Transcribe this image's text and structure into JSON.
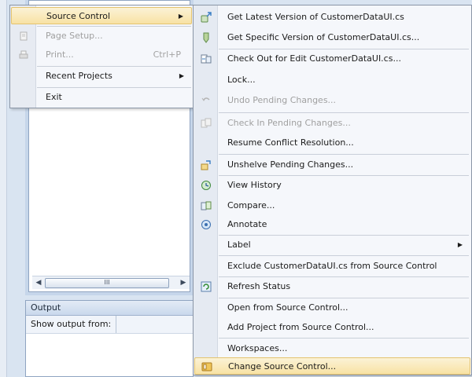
{
  "file_menu": {
    "items": [
      {
        "label": "Source Control",
        "shortcut": "",
        "submenu": true,
        "state": "highlighted",
        "icon": ""
      },
      {
        "label": "Page Setup...",
        "shortcut": "",
        "submenu": false,
        "state": "disabled",
        "icon": "page-setup-icon"
      },
      {
        "label": "Print...",
        "shortcut": "Ctrl+P",
        "submenu": false,
        "state": "disabled",
        "icon": "printer-icon"
      },
      {
        "label": "Recent Projects",
        "shortcut": "",
        "submenu": true,
        "state": "enabled",
        "icon": ""
      },
      {
        "label": "Exit",
        "shortcut": "",
        "submenu": false,
        "state": "enabled",
        "icon": ""
      }
    ]
  },
  "source_control_menu": {
    "items": [
      {
        "label": "Get Latest Version of CustomerDataUI.cs",
        "icon": "get-latest-icon",
        "state": "enabled"
      },
      {
        "label": "Get Specific Version of CustomerDataUI.cs...",
        "icon": "get-specific-icon",
        "state": "enabled"
      },
      {
        "label": "Check Out for Edit CustomerDataUI.cs...",
        "icon": "check-out-icon",
        "state": "enabled"
      },
      {
        "label": "Lock...",
        "icon": "",
        "state": "enabled"
      },
      {
        "label": "Undo Pending Changes...",
        "icon": "undo-icon",
        "state": "disabled"
      },
      {
        "label": "Check In Pending Changes...",
        "icon": "check-in-icon",
        "state": "disabled"
      },
      {
        "label": "Resume Conflict Resolution...",
        "icon": "",
        "state": "enabled"
      },
      {
        "label": "Unshelve Pending Changes...",
        "icon": "unshelve-icon",
        "state": "enabled"
      },
      {
        "label": "View History",
        "icon": "history-icon",
        "state": "enabled"
      },
      {
        "label": "Compare...",
        "icon": "compare-icon",
        "state": "enabled"
      },
      {
        "label": "Annotate",
        "icon": "annotate-icon",
        "state": "enabled"
      },
      {
        "label": "Label",
        "icon": "",
        "state": "enabled",
        "submenu": true
      },
      {
        "label": "Exclude CustomerDataUI.cs from Source Control",
        "icon": "",
        "state": "enabled"
      },
      {
        "label": "Refresh Status",
        "icon": "refresh-icon",
        "state": "enabled"
      },
      {
        "label": "Open from Source Control...",
        "icon": "",
        "state": "enabled"
      },
      {
        "label": "Add Project from Source Control...",
        "icon": "",
        "state": "enabled"
      },
      {
        "label": "Workspaces...",
        "icon": "",
        "state": "enabled"
      },
      {
        "label": "Change Source Control...",
        "icon": "change-source-control-icon",
        "state": "highlighted"
      }
    ]
  },
  "output_panel": {
    "title": "Output",
    "show_output_from": "Show output from:"
  },
  "scrollbar": {
    "thumb_grip": "III"
  },
  "colors": {
    "highlight_top": "#fbf2d6",
    "highlight_bottom": "#f8e2a4",
    "highlight_border": "#e3c36e",
    "menu_bg": "#f5f7fb",
    "disabled_text": "#a0a0a0"
  }
}
